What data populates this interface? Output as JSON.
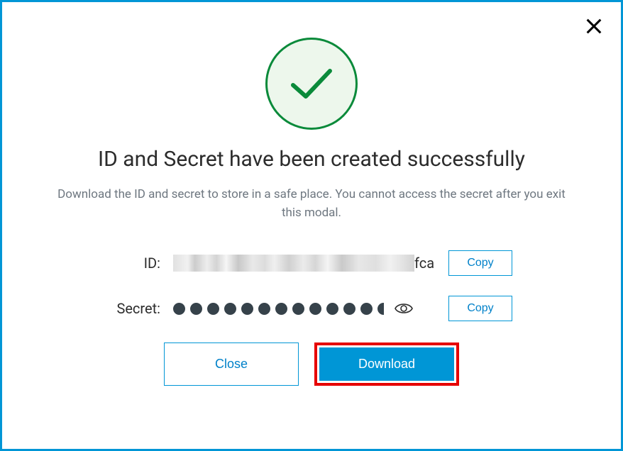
{
  "modal": {
    "title": "ID and Secret have been created successfully",
    "subtext": "Download the ID and secret to store in a safe place. You cannot access the secret after you exit this modal."
  },
  "fields": {
    "id": {
      "label": "ID:",
      "visible_suffix": "fca",
      "copy_label": "Copy"
    },
    "secret": {
      "label": "Secret:",
      "copy_label": "Copy"
    }
  },
  "buttons": {
    "close": "Close",
    "download": "Download"
  }
}
